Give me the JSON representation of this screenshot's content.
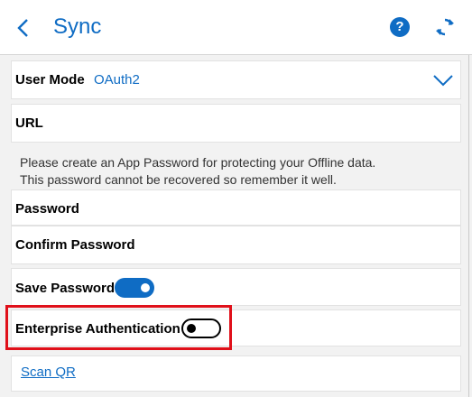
{
  "header": {
    "title": "Sync",
    "help_glyph": "?"
  },
  "form": {
    "user_mode_label": "User Mode",
    "user_mode_value": "OAuth2",
    "url_label": "URL",
    "note_line1": "Please create an App Password for protecting your Offline data.",
    "note_line2": "This password cannot be recovered so remember it well.",
    "password_label": "Password",
    "confirm_password_label": "Confirm Password",
    "save_password_label": "Save Password",
    "save_password_on": true,
    "enterprise_auth_label": "Enterprise Authentication",
    "enterprise_auth_on": false,
    "scan_qr_label": "Scan QR"
  },
  "colors": {
    "accent": "#0f6cc4",
    "highlight": "#e0101a"
  }
}
